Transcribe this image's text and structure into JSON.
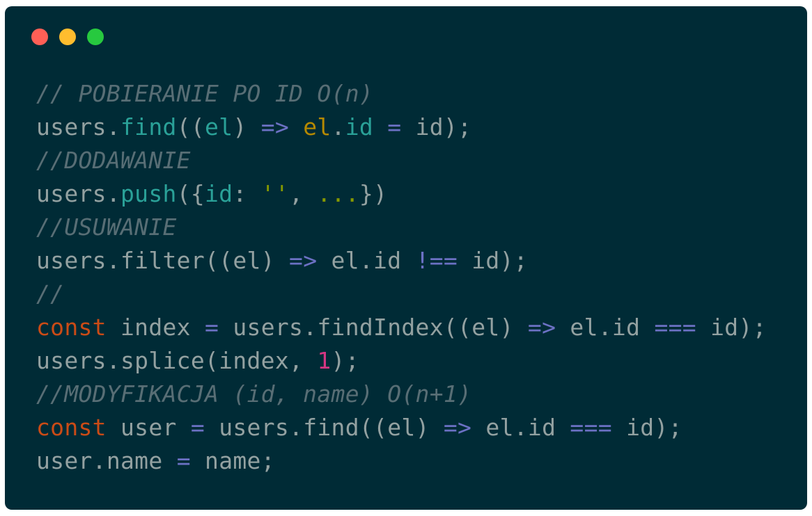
{
  "window": {
    "controls": {
      "close_color": "#ff5f56",
      "minimize_color": "#ffbd2e",
      "maximize_color": "#27c93f"
    },
    "background_color": "#002b36"
  },
  "code": {
    "lines": [
      [
        {
          "t": "comment",
          "v": "// POBIERANIE PO ID O(n)"
        }
      ],
      [
        {
          "t": "plain",
          "v": "users."
        },
        {
          "t": "method",
          "v": "find"
        },
        {
          "t": "plain",
          "v": "(("
        },
        {
          "t": "param",
          "v": "el"
        },
        {
          "t": "plain",
          "v": ") "
        },
        {
          "t": "operator",
          "v": "=>"
        },
        {
          "t": "plain",
          "v": " "
        },
        {
          "t": "var",
          "v": "el"
        },
        {
          "t": "plain",
          "v": "."
        },
        {
          "t": "method",
          "v": "id"
        },
        {
          "t": "plain",
          "v": " "
        },
        {
          "t": "operator",
          "v": "="
        },
        {
          "t": "plain",
          "v": " id);"
        }
      ],
      [
        {
          "t": "comment",
          "v": "//DODAWANIE"
        }
      ],
      [
        {
          "t": "plain",
          "v": "users."
        },
        {
          "t": "method",
          "v": "push"
        },
        {
          "t": "plain",
          "v": "({"
        },
        {
          "t": "param",
          "v": "id"
        },
        {
          "t": "plain",
          "v": ": "
        },
        {
          "t": "string",
          "v": "''"
        },
        {
          "t": "plain",
          "v": ", "
        },
        {
          "t": "string",
          "v": "..."
        },
        {
          "t": "plain",
          "v": "})"
        }
      ],
      [
        {
          "t": "comment",
          "v": "//USUWANIE"
        }
      ],
      [
        {
          "t": "plain",
          "v": "users.filter((el) "
        },
        {
          "t": "operator",
          "v": "=>"
        },
        {
          "t": "plain",
          "v": " el.id "
        },
        {
          "t": "operator",
          "v": "!=="
        },
        {
          "t": "plain",
          "v": " id);"
        }
      ],
      [
        {
          "t": "comment",
          "v": "//"
        }
      ],
      [
        {
          "t": "keyword",
          "v": "const"
        },
        {
          "t": "plain",
          "v": " index "
        },
        {
          "t": "operator",
          "v": "="
        },
        {
          "t": "plain",
          "v": " users.findIndex((el) "
        },
        {
          "t": "operator",
          "v": "=>"
        },
        {
          "t": "plain",
          "v": " el.id "
        },
        {
          "t": "operator",
          "v": "==="
        },
        {
          "t": "plain",
          "v": " id);"
        }
      ],
      [
        {
          "t": "plain",
          "v": "users.splice(index, "
        },
        {
          "t": "number",
          "v": "1"
        },
        {
          "t": "plain",
          "v": ");"
        }
      ],
      [
        {
          "t": "comment",
          "v": "//MODYFIKACJA (id, name) O(n+1)"
        }
      ],
      [
        {
          "t": "keyword",
          "v": "const"
        },
        {
          "t": "plain",
          "v": " user "
        },
        {
          "t": "operator",
          "v": "="
        },
        {
          "t": "plain",
          "v": " users.find((el) "
        },
        {
          "t": "operator",
          "v": "=>"
        },
        {
          "t": "plain",
          "v": " el.id "
        },
        {
          "t": "operator",
          "v": "==="
        },
        {
          "t": "plain",
          "v": " id);"
        }
      ],
      [
        {
          "t": "plain",
          "v": "user.name "
        },
        {
          "t": "operator",
          "v": "="
        },
        {
          "t": "plain",
          "v": " name;"
        }
      ]
    ]
  }
}
